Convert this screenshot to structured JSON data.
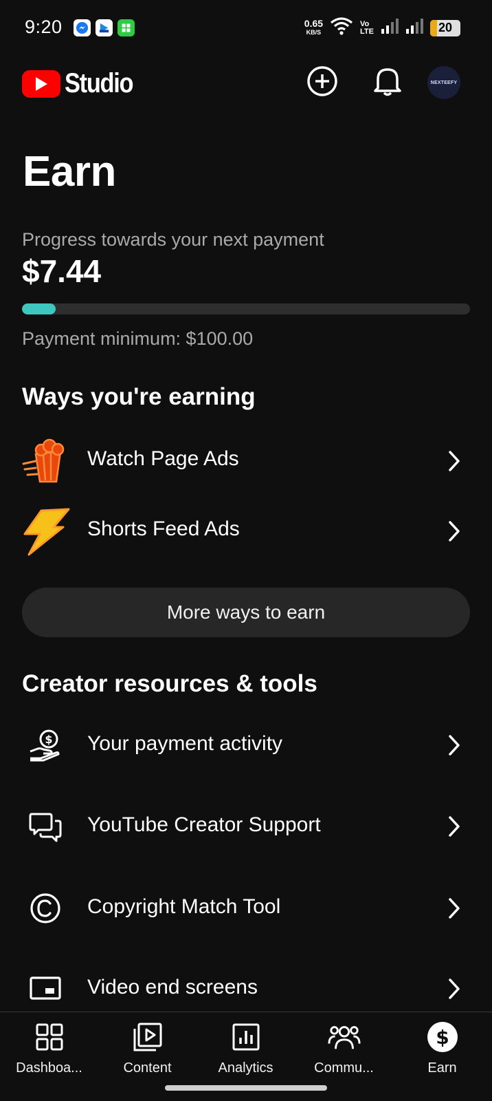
{
  "status_bar": {
    "time": "9:20",
    "network_speed": "0.65",
    "network_unit": "KB/S",
    "volte_top": "Vo",
    "volte_bottom": "LTE",
    "battery": "20",
    "colors": {
      "battery_fill": "#e8a91a"
    }
  },
  "app_bar": {
    "brand": "Studio",
    "avatar_text": "NEXTEEFY",
    "icons": [
      "create-icon",
      "notifications-icon"
    ]
  },
  "earn": {
    "title": "Earn",
    "progress_label": "Progress towards your next payment",
    "amount": "$7.44",
    "progress_fraction": 0.0744,
    "minimum": "Payment minimum: $100.00"
  },
  "ways_earning": {
    "title": "Ways you're earning",
    "items": [
      {
        "label": "Watch Page Ads",
        "icon": "popcorn-icon"
      },
      {
        "label": "Shorts Feed Ads",
        "icon": "lightning-icon"
      }
    ],
    "more_button": "More ways to earn"
  },
  "resources": {
    "title": "Creator resources & tools",
    "items": [
      {
        "label": "Your payment activity",
        "icon": "payment-hand-icon"
      },
      {
        "label": "YouTube Creator Support",
        "icon": "chat-bubbles-icon"
      },
      {
        "label": "Copyright Match Tool",
        "icon": "copyright-icon"
      },
      {
        "label": "Video end screens",
        "icon": "end-screen-icon"
      }
    ]
  },
  "bottom_nav": {
    "items": [
      {
        "label": "Dashboa...",
        "icon": "dashboard-icon"
      },
      {
        "label": "Content",
        "icon": "content-icon"
      },
      {
        "label": "Analytics",
        "icon": "analytics-icon"
      },
      {
        "label": "Commu...",
        "icon": "community-icon"
      },
      {
        "label": "Earn",
        "icon": "earn-icon",
        "active": true
      }
    ]
  },
  "colors": {
    "background": "#0f0f0f",
    "brand_red": "#ff0000",
    "progress_accent": "#3ec7be",
    "muted_text": "#aaaaaa"
  }
}
